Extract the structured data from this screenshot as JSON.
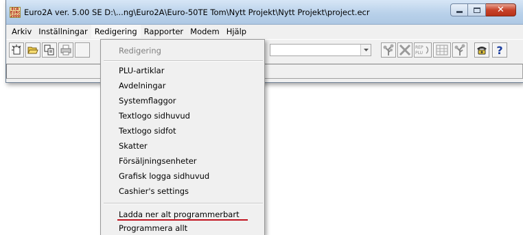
{
  "window": {
    "title": "Euro2A ver. 5.00 SE   D:\\...ng\\Euro2A\\Euro-50TE Tom\\Nytt Projekt\\Nytt Projekt\\project.ecr",
    "app_icon_text": "ECR EURO 2000",
    "close_glyph": "✕"
  },
  "menubar": {
    "items": [
      "Arkiv",
      "Inställningar",
      "Redigering",
      "Rapporter",
      "Modem",
      "Hjälp"
    ]
  },
  "toolbar": {
    "buttons_left": [
      "new-icon",
      "open-folder-icon",
      "copy-icon",
      "print-icon"
    ],
    "buttons_right": [
      "tree-icon",
      "cross-icon",
      "rep-plu-icon",
      "grid-icon",
      "tree-icon-2",
      "phone-icon",
      "help-icon"
    ],
    "rep_plu_text": [
      "REP",
      "PLU"
    ],
    "help_glyph": "?"
  },
  "dropdown": {
    "header": "Redigering",
    "items": [
      "PLU-artiklar",
      "Avdelningar",
      "Systemflaggor",
      "Textlogo sidhuvud",
      "Textlogo sidfot",
      "Skatter",
      "Försäljningsenheter",
      "Grafisk logga sidhuvud",
      "Cashier's settings"
    ],
    "items_after_sep": [
      "Ladda ner alt programmerbart",
      "Programmera allt"
    ],
    "highlight_color": "#c0101c"
  }
}
